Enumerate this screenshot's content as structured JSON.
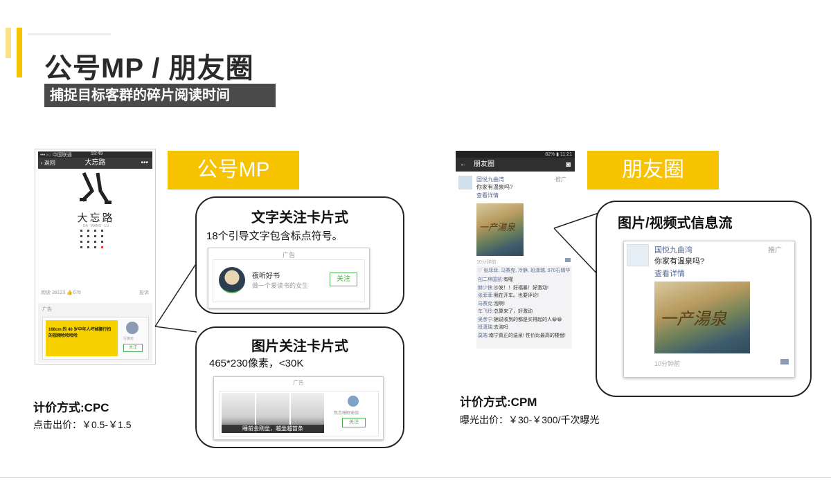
{
  "header": {
    "title": "公号MP / 朋友圈",
    "subtitle": "捕捉目标客群的碎片阅读时间"
  },
  "mp": {
    "tag": "公号MP",
    "phone": {
      "status_left": "•••○○ 中国联通",
      "status_time": "18:49",
      "back": "返回",
      "nav_title": "大忘路",
      "brand": "大忘路",
      "brand_sub": "DA · WANG · LU",
      "stats": "阅读 38123  👍678",
      "report": "投诉",
      "ad_label": "广告",
      "ad_banner": "168cm 的 40 岁中年人坏掉腰行拍的视频哈哈哈哈",
      "ad_account": "行旅花",
      "follow": "关注"
    },
    "text_card": {
      "title": "文字关注卡片式",
      "desc": "18个引导文字包含标点符号。",
      "ad_label": "广告",
      "account": "夜听好书",
      "slogan": "做一个爱读书的女生",
      "follow": "关注"
    },
    "image_card": {
      "title": "图片关注卡片式",
      "desc": "465*230像素，<30K",
      "ad_label": "广告",
      "caption": "睡前金刚坐，越坐越苗条",
      "account": "熬恋睡眠瑜伽",
      "follow": "关注"
    },
    "pricing": {
      "label": "计价方式:CPC",
      "value": "点击出价：￥0.5-￥1.5"
    }
  },
  "moments": {
    "tag": "朋友圈",
    "phone": {
      "status_right": "82% ▮ 11:21",
      "nav_title": "朋友圈",
      "account": "国悦九曲湾",
      "promo": "推广",
      "text": "你家有温泉吗?",
      "details": "查看详情",
      "photo_text": "一产湯泉",
      "time": "10分钟前",
      "likes": "♡ 张菲菲, 马赛克, 冷静, 班潇瑞, 970石晴华",
      "comments": [
        {
          "name": "创二林国凯:",
          "text": "有喔"
        },
        {
          "name": "赫少侠:",
          "text": "沙发！！好福暴！好激动!"
        },
        {
          "name": "张菲菲:",
          "text": "我在开车。也要评论!"
        },
        {
          "name": "马赛克:",
          "text": "泡啊!"
        },
        {
          "name": "车飞玲:",
          "text": "总算来了，好激动"
        },
        {
          "name": "吴彦宁:",
          "text": "据说收到的都是买得起的人😀😀"
        },
        {
          "name": "班潇瑞:",
          "text": "去泡吗"
        },
        {
          "name": "莫皓:",
          "text": "南宁真正的温泉! 性价比最高的楼盘!"
        }
      ]
    },
    "bubble": {
      "title": "图片/视频式信息流",
      "account": "国悦九曲湾",
      "promo": "推广",
      "text": "你家有温泉吗?",
      "details": "查看详情",
      "photo_text": "一产湯泉",
      "time": "10分钟前"
    },
    "pricing": {
      "label": "计价方式:CPM",
      "value": "曝光出价：￥30-￥300/千次曝光"
    }
  }
}
